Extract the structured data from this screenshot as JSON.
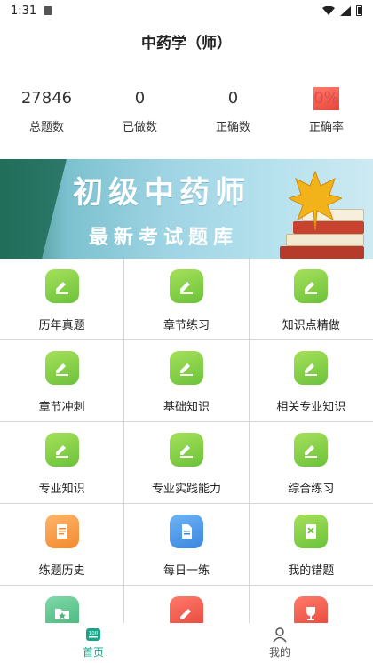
{
  "status_bar": {
    "time": "1:31"
  },
  "header": {
    "title": "中药学（师）"
  },
  "stats": [
    {
      "value": "27846",
      "label": "总题数",
      "highlight": false
    },
    {
      "value": "0",
      "label": "已做数",
      "highlight": false
    },
    {
      "value": "0",
      "label": "正确数",
      "highlight": false
    },
    {
      "value": "0%",
      "label": "正确率",
      "highlight": true
    }
  ],
  "banner": {
    "title": "初级中药师",
    "subtitle": "最新考试题库"
  },
  "grid": {
    "rows": [
      [
        {
          "label": "历年真题",
          "icon": "pen-note-icon",
          "color": "#7ccb45"
        },
        {
          "label": "章节练习",
          "icon": "pen-note-icon",
          "color": "#7ccb45"
        },
        {
          "label": "知识点精做",
          "icon": "pen-note-icon",
          "color": "#7ccb45"
        }
      ],
      [
        {
          "label": "章节冲刺",
          "icon": "pen-note-icon",
          "color": "#7ccb45"
        },
        {
          "label": "基础知识",
          "icon": "pen-note-icon",
          "color": "#7ccb45"
        },
        {
          "label": "相关专业知识",
          "icon": "pen-note-icon",
          "color": "#7ccb45"
        }
      ],
      [
        {
          "label": "专业知识",
          "icon": "pen-note-icon",
          "color": "#7ccb45"
        },
        {
          "label": "专业实践能力",
          "icon": "pen-note-icon",
          "color": "#7ccb45"
        },
        {
          "label": "综合练习",
          "icon": "pen-note-icon",
          "color": "#7ccb45"
        }
      ],
      [
        {
          "label": "练题历史",
          "icon": "history-book-icon",
          "color": "#f59a3c"
        },
        {
          "label": "每日一练",
          "icon": "document-icon",
          "color": "#4b93e6"
        },
        {
          "label": "我的错题",
          "icon": "wrong-book-icon",
          "color": "#7ccb45"
        }
      ],
      [
        {
          "label": "",
          "icon": "star-folder-icon",
          "color": "#57c28a"
        },
        {
          "label": "",
          "icon": "pencil-icon",
          "color": "#ee5a4a"
        },
        {
          "label": "",
          "icon": "trophy-icon",
          "color": "#ee5a4a"
        }
      ]
    ]
  },
  "tabbar": {
    "items": [
      {
        "label": "首页",
        "icon": "home-100-icon",
        "active": true
      },
      {
        "label": "我的",
        "icon": "person-icon",
        "active": false
      }
    ],
    "accent": "#1aa58a"
  }
}
